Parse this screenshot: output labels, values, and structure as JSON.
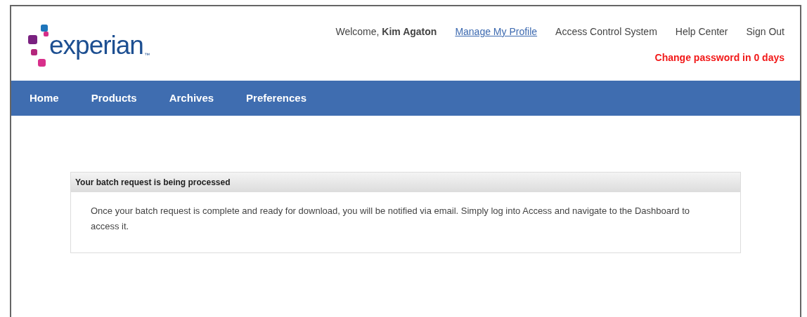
{
  "logo": {
    "wordmark": "experian",
    "trademark": "™"
  },
  "header_links": [
    {
      "kind": "text",
      "label": "Welcome, **Kim Agaton**"
    },
    {
      "kind": "link",
      "label": "Manage My Profile"
    },
    {
      "kind": "plain",
      "label": "Access Control System"
    },
    {
      "kind": "plain",
      "label": "Help Center"
    },
    {
      "kind": "plain",
      "label": "Sign Out"
    }
  ],
  "password_notice": "Change password in 0 days",
  "nav": [
    "Home",
    "Products",
    "Archives",
    "Preferences"
  ],
  "panel": {
    "title": "Your batch request is being processed",
    "message": "Once your batch request is complete and ready for download, you will be notified via email. Simply log into Access and navigate to the Dashboard to access it."
  }
}
